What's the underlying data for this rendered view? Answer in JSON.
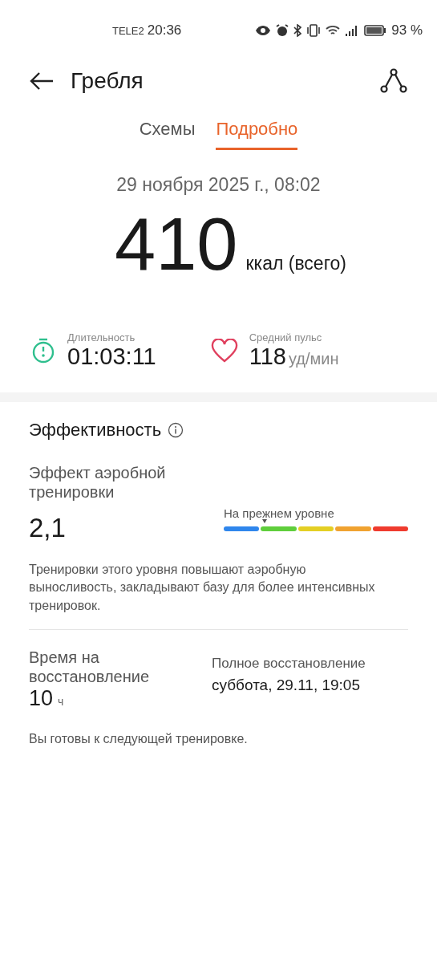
{
  "status_bar": {
    "carrier": "TELE2",
    "time": "20:36",
    "battery": "93 %"
  },
  "header": {
    "title": "Гребля"
  },
  "tabs": [
    {
      "label": "Схемы",
      "selected": false
    },
    {
      "label": "Подробно",
      "selected": true
    }
  ],
  "summary": {
    "date": "29 ноября 2025 г., 08:02",
    "calories": "410",
    "calories_unit": "ккал (всего)"
  },
  "stats": [
    {
      "kind": "duration",
      "label": "Длительность",
      "value": "01:03:11"
    },
    {
      "kind": "pulse",
      "label": "Средний пульс",
      "value": "118",
      "unit": "уд/мин"
    }
  ],
  "effectiveness": {
    "title": "Эффективность",
    "aerobic": {
      "label": "Эффект аэробной тренировки",
      "value": "2,1",
      "scale_label": "На прежнем уровне",
      "segments": [
        {
          "color": "#2f86ec"
        },
        {
          "color": "#5fce3c"
        },
        {
          "color": "#e4cf24"
        },
        {
          "color": "#f0a230"
        },
        {
          "color": "#ef3b2e"
        }
      ]
    },
    "description": "Тренировки этого уровня повышают аэробную выносливость, закладывают базу для более интенсивных тренировок.",
    "recovery": {
      "label": "Время на восстановление",
      "value": "10",
      "unit": "ч",
      "full_label": "Полное восстановление",
      "full_value": "суббота, 29.11, 19:05"
    },
    "note": "Вы готовы к следующей тренировке."
  }
}
